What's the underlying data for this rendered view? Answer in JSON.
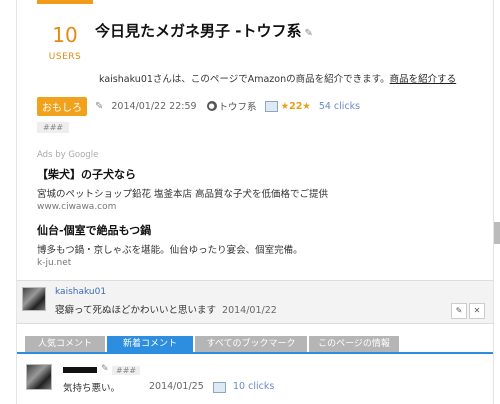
{
  "header": {
    "users_count": "10",
    "users_label": "USERS",
    "title": "今日見たメガネ男子 -トウフ系"
  },
  "promo": {
    "text": "kaishaku01さんは、このページでAmazonの商品を紹介できます。",
    "link": "商品を紹介する"
  },
  "meta": {
    "tag": "おもしろ",
    "date": "2014/01/22 22:59",
    "category": "トウフ系",
    "stars": "★22★",
    "clicks": "54 clicks"
  },
  "hashtag": "###",
  "ads": {
    "by": "Ads by Google",
    "items": [
      {
        "title": "【柴犬】の子犬なら",
        "desc": "宮城のペットショップ鉛花 塩釜本店 高品質な子犬を低価格でご提供",
        "url": "www.ciwawa.com"
      },
      {
        "title": "仙台-個室で絶品もつ鍋",
        "desc": "博多もつ鍋・京しゃぶを堪能。仙台ゆったり宴会、個室完備。",
        "url": "k-ju.net"
      }
    ]
  },
  "comment": {
    "user": "kaishaku01",
    "text": "寝癖って死ぬほどかわいいと思います",
    "date": "2014/01/22"
  },
  "tabs": [
    "人気コメント",
    "新着コメント",
    "すべてのブックマーク",
    "このページの情報"
  ],
  "recent": {
    "hashtag": "###",
    "text": "気持ち悪い。",
    "date": "2014/01/25",
    "clicks": "10 clicks"
  },
  "colors": {
    "accent": "#f29b18",
    "link": "#3b6bb5",
    "tab_active": "#2d8ee0"
  },
  "icons": [
    "pencil-icon",
    "category-circle-icon",
    "image-icon",
    "edit-icon",
    "close-icon"
  ]
}
